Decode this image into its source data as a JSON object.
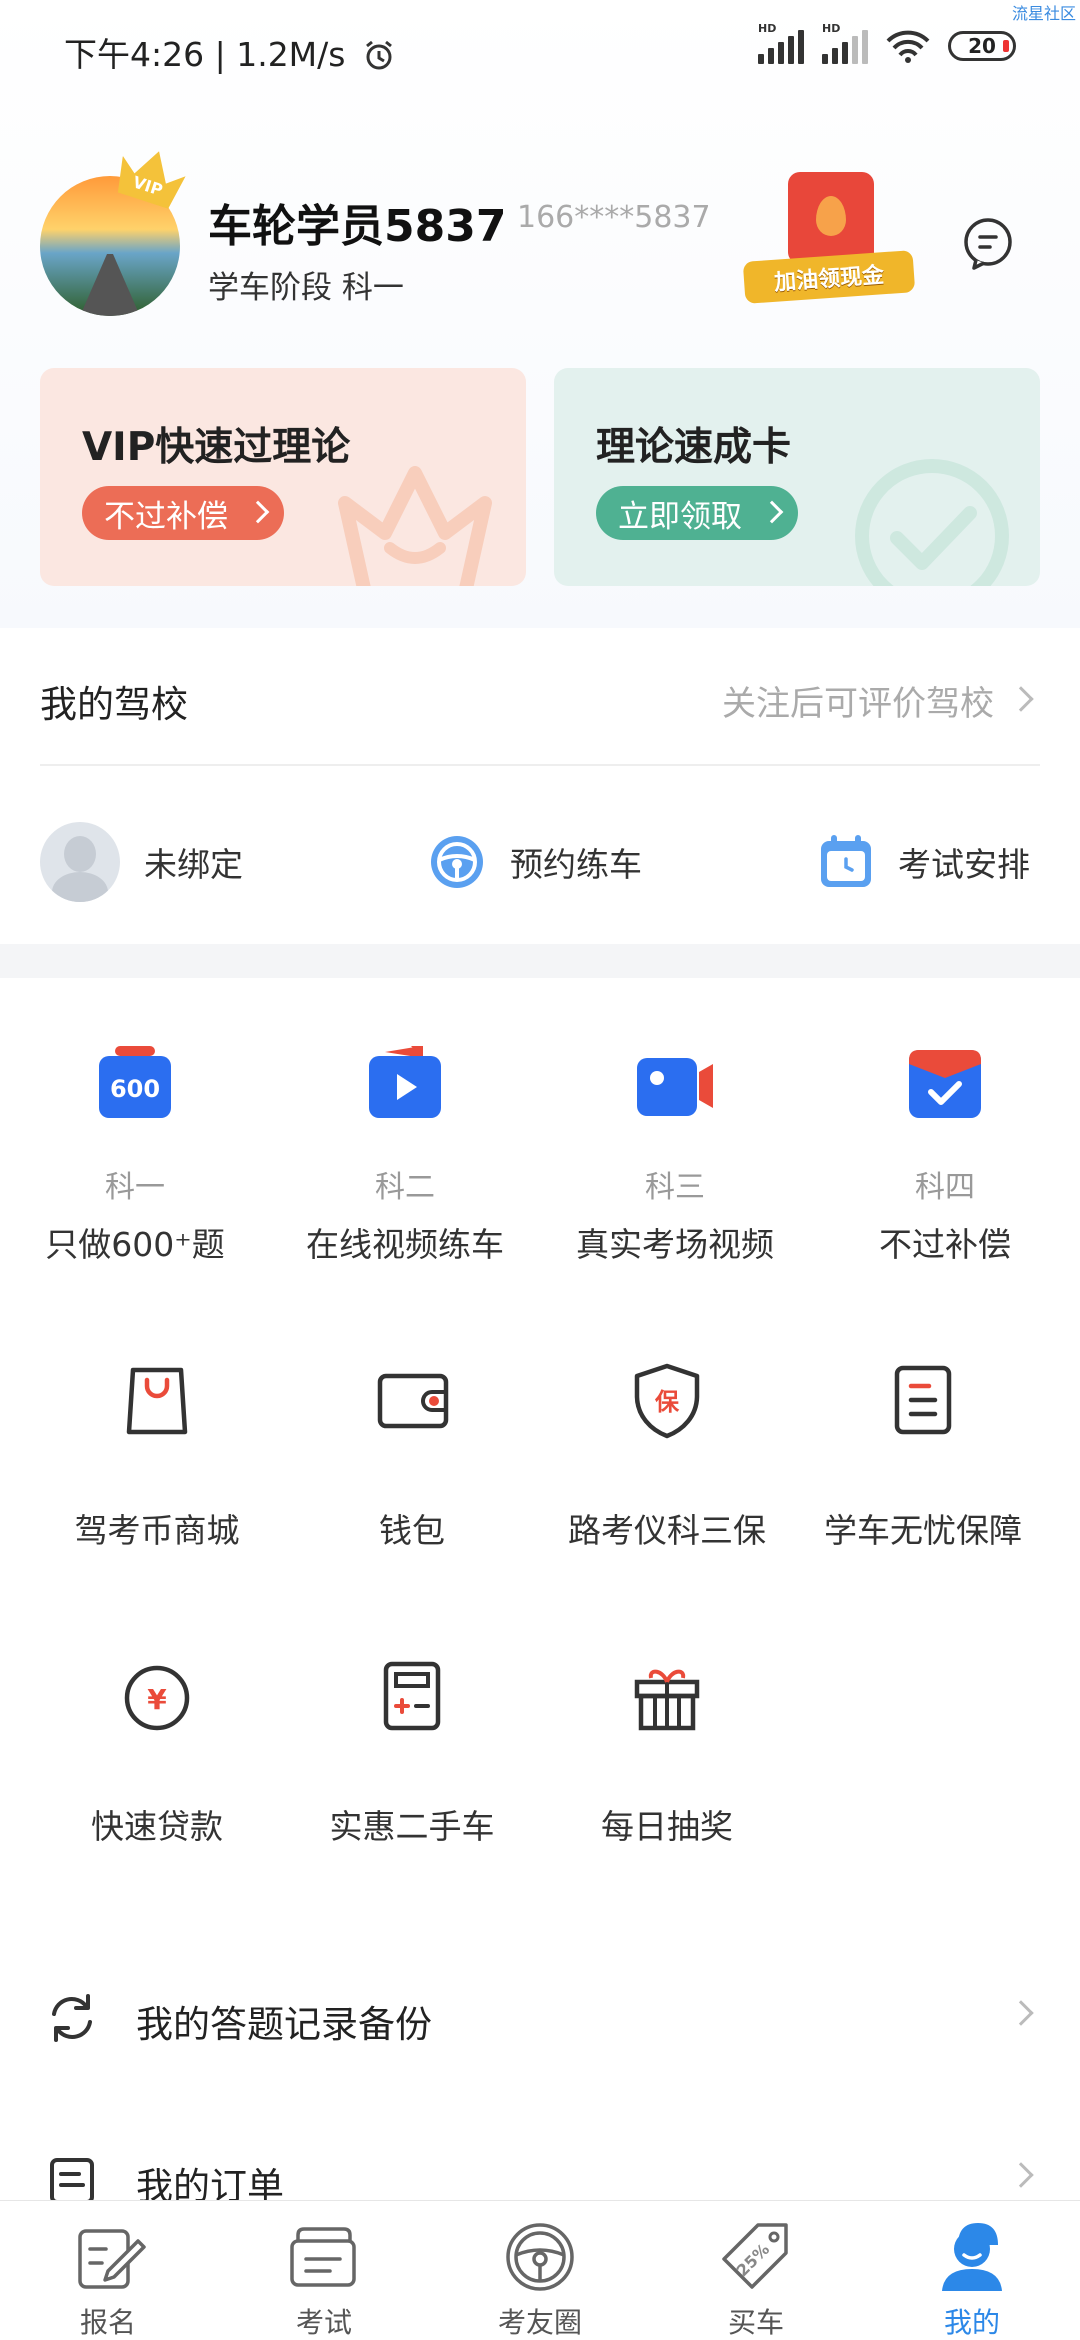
{
  "status_bar": {
    "time_net": "下午4:26 | 1.2M/s",
    "signal1": "HD",
    "signal2": "HD",
    "battery": "20",
    "watermark": "流星社区"
  },
  "profile": {
    "username": "车轮学员5837",
    "phone": "166****5837",
    "stage": "学车阶段 科一",
    "vip_badge": "VIP",
    "promo_label": "加油领现金"
  },
  "cards": [
    {
      "title": "VIP快速过理论",
      "button": "不过补偿"
    },
    {
      "title": "理论速成卡",
      "button": "立即领取"
    }
  ],
  "school": {
    "title": "我的驾校",
    "hint": "关注后可评价驾校",
    "actions": [
      {
        "label": "未绑定",
        "icon": "user-placeholder-icon"
      },
      {
        "label": "预约练车",
        "icon": "steering-wheel-icon"
      },
      {
        "label": "考试安排",
        "icon": "calendar-icon"
      }
    ]
  },
  "subjects": [
    {
      "sub": "科一",
      "label": "只做600⁺题",
      "icon": "600-questions-icon",
      "icon_text": "600"
    },
    {
      "sub": "科二",
      "label": "在线视频练车",
      "icon": "video-play-icon"
    },
    {
      "sub": "科三",
      "label": "真实考场视频",
      "icon": "video-camera-icon"
    },
    {
      "sub": "科四",
      "label": "不过补偿",
      "icon": "check-envelope-icon"
    }
  ],
  "services": [
    {
      "label": "驾考币商城",
      "icon": "shopping-bag-icon"
    },
    {
      "label": "钱包",
      "icon": "wallet-icon"
    },
    {
      "label": "路考仪科三保",
      "icon": "shield-icon",
      "icon_text": "保"
    },
    {
      "label": "学车无忧保障",
      "icon": "document-icon"
    },
    {
      "label": "快速贷款",
      "icon": "yuan-coin-icon",
      "icon_text": "¥"
    },
    {
      "label": "实惠二手车",
      "icon": "calculator-icon"
    },
    {
      "label": "每日抽奖",
      "icon": "gift-icon"
    }
  ],
  "list": [
    {
      "label": "我的答题记录备份",
      "icon": "sync-icon"
    },
    {
      "label": "我的订单",
      "icon": "order-icon"
    }
  ],
  "tabs": [
    {
      "label": "报名",
      "icon": "edit-icon"
    },
    {
      "label": "考试",
      "icon": "exam-card-icon"
    },
    {
      "label": "考友圈",
      "icon": "steering-wheel-icon"
    },
    {
      "label": "买车",
      "icon": "price-tag-icon",
      "icon_text": "25%"
    },
    {
      "label": "我的",
      "icon": "person-icon",
      "active": true
    }
  ],
  "colors": {
    "accent": "#2c88e8",
    "vip_button": "#ec6d56",
    "theory_button": "#4fb192",
    "subject_blue": "#2b6ef0",
    "subject_red": "#ea4b3a"
  }
}
